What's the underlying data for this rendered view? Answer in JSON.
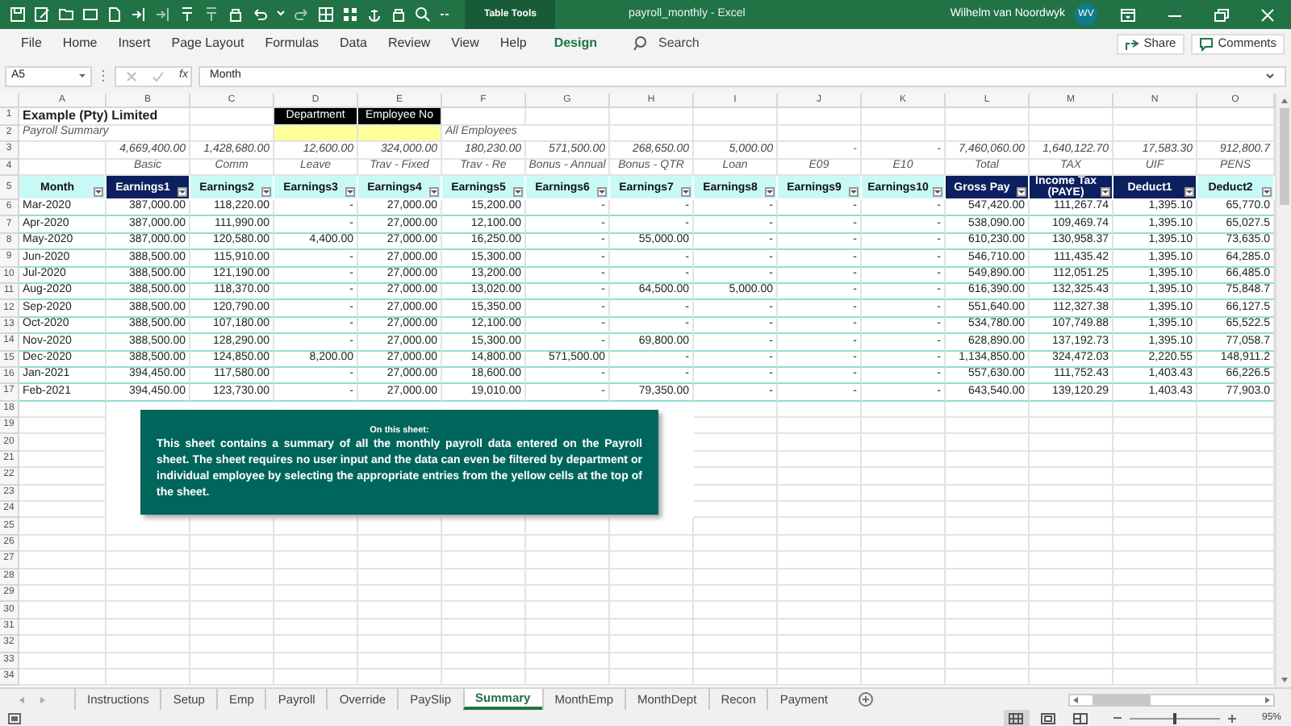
{
  "window": {
    "title": "payroll_monthly - Excel",
    "context_tab": "Table Tools",
    "user": "Wilhelm van Noordwyk",
    "user_initials": "WV"
  },
  "ribbon_tabs": [
    {
      "label": "File",
      "kind": "plain"
    },
    {
      "label": "Home",
      "kind": "plain"
    },
    {
      "label": "Insert",
      "kind": "plain"
    },
    {
      "label": "Page Layout",
      "kind": "plain"
    },
    {
      "label": "Formulas",
      "kind": "plain"
    },
    {
      "label": "Data",
      "kind": "plain"
    },
    {
      "label": "Review",
      "kind": "plain"
    },
    {
      "label": "View",
      "kind": "plain"
    },
    {
      "label": "Help",
      "kind": "plain"
    },
    {
      "label": "Design",
      "kind": "contextual"
    }
  ],
  "search": {
    "placeholder": "Search"
  },
  "share_button": "Share",
  "comments_button": "Comments",
  "formula_bar": {
    "name_box": "A5",
    "function_label": "fx",
    "formula": "Month"
  },
  "column_headers": [
    "A",
    "B",
    "C",
    "D",
    "E",
    "F",
    "G",
    "H",
    "I",
    "J",
    "K",
    "L",
    "M",
    "N",
    "O"
  ],
  "row_numbers": [
    "1",
    "2",
    "3",
    "4",
    "5",
    "6",
    "7",
    "8",
    "9",
    "10",
    "11",
    "12",
    "13",
    "14",
    "15",
    "16",
    "17",
    "18",
    "19",
    "20",
    "21",
    "22",
    "23",
    "24",
    "25",
    "26",
    "27",
    "28",
    "29",
    "30",
    "31",
    "32",
    "33",
    "34"
  ],
  "sheet_header": {
    "company": "Example (Pty) Limited",
    "subtitle": "Payroll Summary",
    "department_label": "Department",
    "employee_label": "Employee No",
    "filter_note": "All Employees"
  },
  "totals": [
    "4,669,400.00",
    "1,428,680.00",
    "12,600.00",
    "324,000.00",
    "180,230.00",
    "571,500.00",
    "268,650.00",
    "5,000.00",
    "-",
    "-",
    "7,460,060.00",
    "1,640,122.70",
    "17,583.30",
    "912,800.7"
  ],
  "descriptions": [
    "Basic",
    "Comm",
    "Leave",
    "Trav - Fixed",
    "Trav - Re",
    "Bonus - Annual",
    "Bonus - QTR",
    "Loan",
    "E09",
    "E10",
    "Total",
    "TAX",
    "UIF",
    "PENS"
  ],
  "table": {
    "columns": [
      {
        "label": "Month",
        "kind": "light"
      },
      {
        "label": "Earnings1",
        "kind": "dark"
      },
      {
        "label": "Earnings2",
        "kind": "light"
      },
      {
        "label": "Earnings3",
        "kind": "light"
      },
      {
        "label": "Earnings4",
        "kind": "light"
      },
      {
        "label": "Earnings5",
        "kind": "light"
      },
      {
        "label": "Earnings6",
        "kind": "light"
      },
      {
        "label": "Earnings7",
        "kind": "light"
      },
      {
        "label": "Earnings8",
        "kind": "light"
      },
      {
        "label": "Earnings9",
        "kind": "light"
      },
      {
        "label": "Earnings10",
        "kind": "light"
      },
      {
        "label": "Gross Pay",
        "kind": "dark"
      },
      {
        "label": "Income Tax (PAYE)",
        "kind": "dark"
      },
      {
        "label": "Deduct1",
        "kind": "dark"
      },
      {
        "label": "Deduct2",
        "kind": "light"
      }
    ],
    "rows": [
      [
        "Mar-2020",
        "387,000.00",
        "118,220.00",
        "-",
        "27,000.00",
        "15,200.00",
        "-",
        "-",
        "-",
        "-",
        "-",
        "547,420.00",
        "111,267.74",
        "1,395.10",
        "65,770.0"
      ],
      [
        "Apr-2020",
        "387,000.00",
        "111,990.00",
        "-",
        "27,000.00",
        "12,100.00",
        "-",
        "-",
        "-",
        "-",
        "-",
        "538,090.00",
        "109,469.74",
        "1,395.10",
        "65,027.5"
      ],
      [
        "May-2020",
        "387,000.00",
        "120,580.00",
        "4,400.00",
        "27,000.00",
        "16,250.00",
        "-",
        "55,000.00",
        "-",
        "-",
        "-",
        "610,230.00",
        "130,958.37",
        "1,395.10",
        "73,635.0"
      ],
      [
        "Jun-2020",
        "388,500.00",
        "115,910.00",
        "-",
        "27,000.00",
        "15,300.00",
        "-",
        "-",
        "-",
        "-",
        "-",
        "546,710.00",
        "111,435.42",
        "1,395.10",
        "64,285.0"
      ],
      [
        "Jul-2020",
        "388,500.00",
        "121,190.00",
        "-",
        "27,000.00",
        "13,200.00",
        "-",
        "-",
        "-",
        "-",
        "-",
        "549,890.00",
        "112,051.25",
        "1,395.10",
        "66,485.0"
      ],
      [
        "Aug-2020",
        "388,500.00",
        "118,370.00",
        "-",
        "27,000.00",
        "13,020.00",
        "-",
        "64,500.00",
        "5,000.00",
        "-",
        "-",
        "616,390.00",
        "132,325.43",
        "1,395.10",
        "75,848.7"
      ],
      [
        "Sep-2020",
        "388,500.00",
        "120,790.00",
        "-",
        "27,000.00",
        "15,350.00",
        "-",
        "-",
        "-",
        "-",
        "-",
        "551,640.00",
        "112,327.38",
        "1,395.10",
        "66,127.5"
      ],
      [
        "Oct-2020",
        "388,500.00",
        "107,180.00",
        "-",
        "27,000.00",
        "12,100.00",
        "-",
        "-",
        "-",
        "-",
        "-",
        "534,780.00",
        "107,749.88",
        "1,395.10",
        "65,522.5"
      ],
      [
        "Nov-2020",
        "388,500.00",
        "128,290.00",
        "-",
        "27,000.00",
        "15,300.00",
        "-",
        "69,800.00",
        "-",
        "-",
        "-",
        "628,890.00",
        "137,192.73",
        "1,395.10",
        "77,058.7"
      ],
      [
        "Dec-2020",
        "388,500.00",
        "124,850.00",
        "8,200.00",
        "27,000.00",
        "14,800.00",
        "571,500.00",
        "-",
        "-",
        "-",
        "-",
        "1,134,850.00",
        "324,472.03",
        "2,220.55",
        "148,911.2"
      ],
      [
        "Jan-2021",
        "394,450.00",
        "117,580.00",
        "-",
        "27,000.00",
        "18,600.00",
        "-",
        "-",
        "-",
        "-",
        "-",
        "557,630.00",
        "111,752.43",
        "1,403.43",
        "66,226.5"
      ],
      [
        "Feb-2021",
        "394,450.00",
        "123,730.00",
        "-",
        "27,000.00",
        "19,010.00",
        "-",
        "79,350.00",
        "-",
        "-",
        "-",
        "643,540.00",
        "139,120.29",
        "1,403.43",
        "77,903.0"
      ]
    ]
  },
  "note": {
    "title": "On this sheet:",
    "body": "This sheet contains a summary of all the monthly payroll data entered on the Payroll sheet. The sheet requires no user input and the data can even be filtered by department or individual employee by selecting the appropriate entries from the yellow cells at the top of the sheet."
  },
  "sheet_tabs": [
    {
      "label": "Instructions",
      "selected": false
    },
    {
      "label": "Setup",
      "selected": false
    },
    {
      "label": "Emp",
      "selected": false
    },
    {
      "label": "Payroll",
      "selected": false
    },
    {
      "label": "Override",
      "selected": false
    },
    {
      "label": "PaySlip",
      "selected": false
    },
    {
      "label": "Summary",
      "selected": true
    },
    {
      "label": "MonthEmp",
      "selected": false
    },
    {
      "label": "MonthDept",
      "selected": false
    },
    {
      "label": "Recon",
      "selected": false
    },
    {
      "label": "Payment",
      "selected": false
    }
  ],
  "status_bar": {
    "views": [
      {
        "kind": "normal",
        "selected": true
      },
      {
        "kind": "page_layout",
        "selected": false
      },
      {
        "kind": "page_break",
        "selected": false
      }
    ],
    "zoom": {
      "level": 0.48
    },
    "zoom_label": "95%"
  }
}
